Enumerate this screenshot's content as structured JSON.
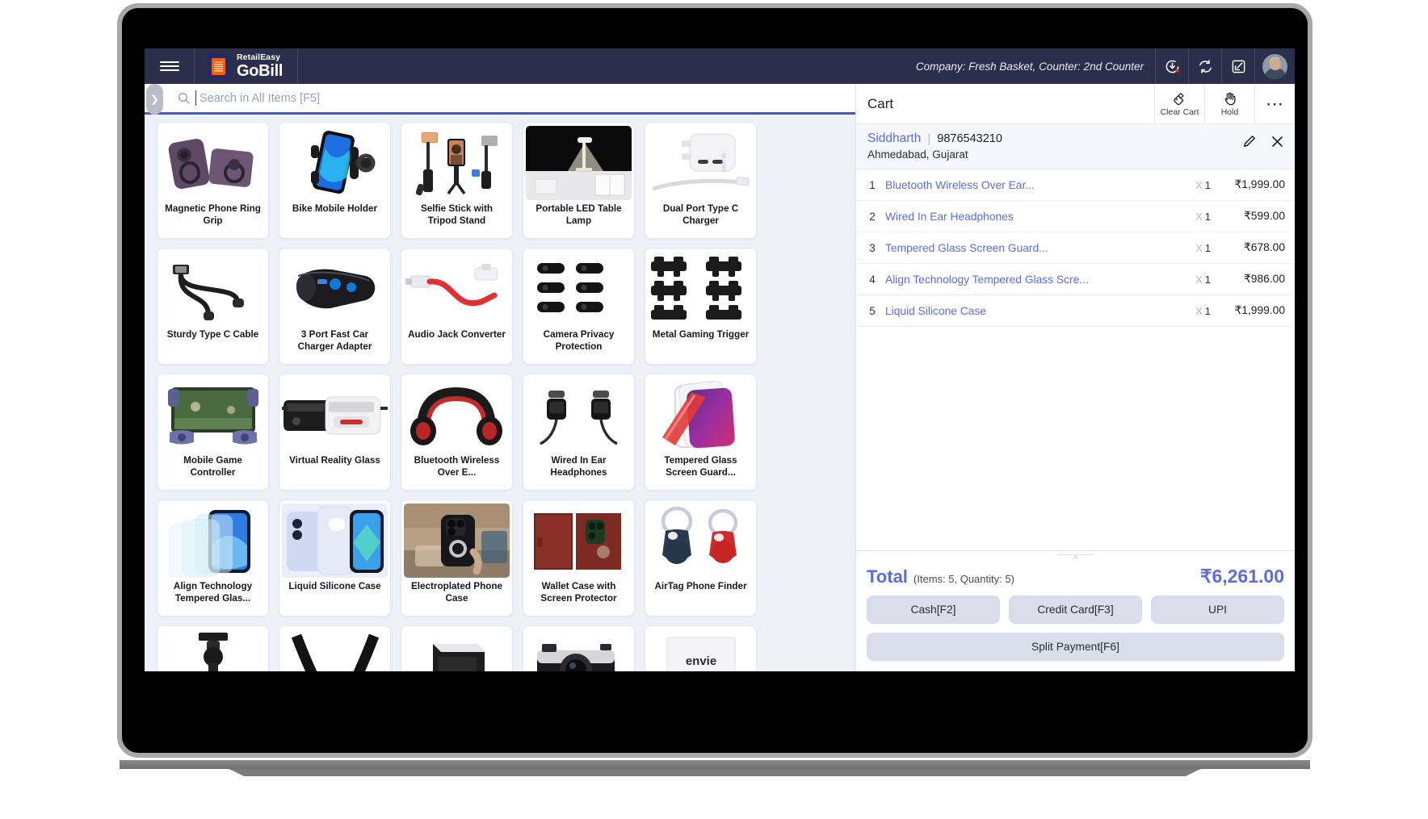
{
  "topbar": {
    "menu_icon": "hamburger-icon",
    "brand_top": "RetailEasy",
    "brand_bottom": "GoBill",
    "company_counter": "Company: Fresh Basket,  Counter: 2nd Counter",
    "icons": [
      {
        "name": "pending-download-icon"
      },
      {
        "name": "sync-refresh-icon"
      },
      {
        "name": "collapse-screen-icon"
      }
    ],
    "avatar": "user-avatar"
  },
  "search": {
    "placeholder": "Search in All Items [F5]",
    "value": "",
    "icon": "search-icon",
    "toggle_icon": "chevron-right-icon"
  },
  "products": [
    {
      "label": "Magnetic Phone Ring Grip",
      "img": "ring-grip"
    },
    {
      "label": "Bike Mobile Holder",
      "img": "bike-holder"
    },
    {
      "label": "Selfie Stick with Tripod Stand",
      "img": "selfie-stick"
    },
    {
      "label": "Portable LED Table Lamp",
      "img": "led-lamp"
    },
    {
      "label": "Dual Port Type C Charger",
      "img": "dual-charger"
    },
    {
      "label": "Sturdy Type C Cable",
      "img": "type-c-cable"
    },
    {
      "label": "3 Port Fast Car Charger Adapter",
      "img": "car-charger"
    },
    {
      "label": "Audio Jack Converter",
      "img": "audio-jack"
    },
    {
      "label": "Camera Privacy Protection",
      "img": "camera-privacy"
    },
    {
      "label": "Metal Gaming Trigger",
      "img": "gaming-trigger"
    },
    {
      "label": "Mobile Game Controller",
      "img": "game-controller"
    },
    {
      "label": "Virtual Reality Glass",
      "img": "vr-glass"
    },
    {
      "label": "Bluetooth Wireless Over E...",
      "img": "bt-headphones"
    },
    {
      "label": "Wired In Ear Headphones",
      "img": "wired-earphones"
    },
    {
      "label": "Tempered Glass Screen Guard...",
      "img": "tempered-red"
    },
    {
      "label": "Align Technology Tempered Glas...",
      "img": "align-glass"
    },
    {
      "label": "Liquid Silicone Case",
      "img": "silicone-case"
    },
    {
      "label": "Electroplated Phone Case",
      "img": "electroplated"
    },
    {
      "label": "Wallet Case with Screen Protector",
      "img": "wallet-case"
    },
    {
      "label": "AirTag Phone Finder",
      "img": "airtag"
    },
    {
      "label": "",
      "img": "tripod-head"
    },
    {
      "label": "",
      "img": "camera-strap"
    },
    {
      "label": "",
      "img": "flash-unit"
    },
    {
      "label": "",
      "img": "camera-body"
    },
    {
      "label": "",
      "img": "envie-box"
    }
  ],
  "cart": {
    "title": "Cart",
    "clear_label": "Clear Cart",
    "clear_icon": "broom-icon",
    "hold_label": "Hold",
    "hold_icon": "hand-icon",
    "more_icon": "more-dots-icon",
    "customer": {
      "name": "Siddharth",
      "separator": "|",
      "phone": "9876543210",
      "address": "Ahmedabad, Gujarat",
      "edit_icon": "pencil-icon",
      "remove_icon": "close-icon"
    },
    "items": [
      {
        "no": "1",
        "name": "Bluetooth Wireless Over Ear...",
        "qty": "1",
        "price": "₹1,999.00"
      },
      {
        "no": "2",
        "name": "Wired In Ear Headphones",
        "qty": "1",
        "price": "₹599.00"
      },
      {
        "no": "3",
        "name": "Tempered Glass Screen Guard...",
        "qty": "1",
        "price": "₹678.00"
      },
      {
        "no": "4",
        "name": "Align Technology Tempered Glass Scre...",
        "qty": "1",
        "price": "₹986.00"
      },
      {
        "no": "5",
        "name": "Liquid Silicone Case",
        "qty": "1",
        "price": "₹1,999.00"
      }
    ],
    "qty_prefix": "X",
    "totals": {
      "label": "Total",
      "meta": "(Items: 5, Quantity: 5)",
      "amount": "₹6,261.00",
      "collapse_icon": "chevron-up-icon"
    },
    "payment": {
      "cash": "Cash[F2]",
      "credit": "Credit Card[F3]",
      "upi": "UPI",
      "split": "Split Payment[F6]"
    }
  },
  "colors": {
    "topbar": "#2b2f4c",
    "accent": "#5b6ee0",
    "search_underline": "#4158d0",
    "page_bg": "#eef0f8",
    "button_bg": "#dadeeb"
  }
}
